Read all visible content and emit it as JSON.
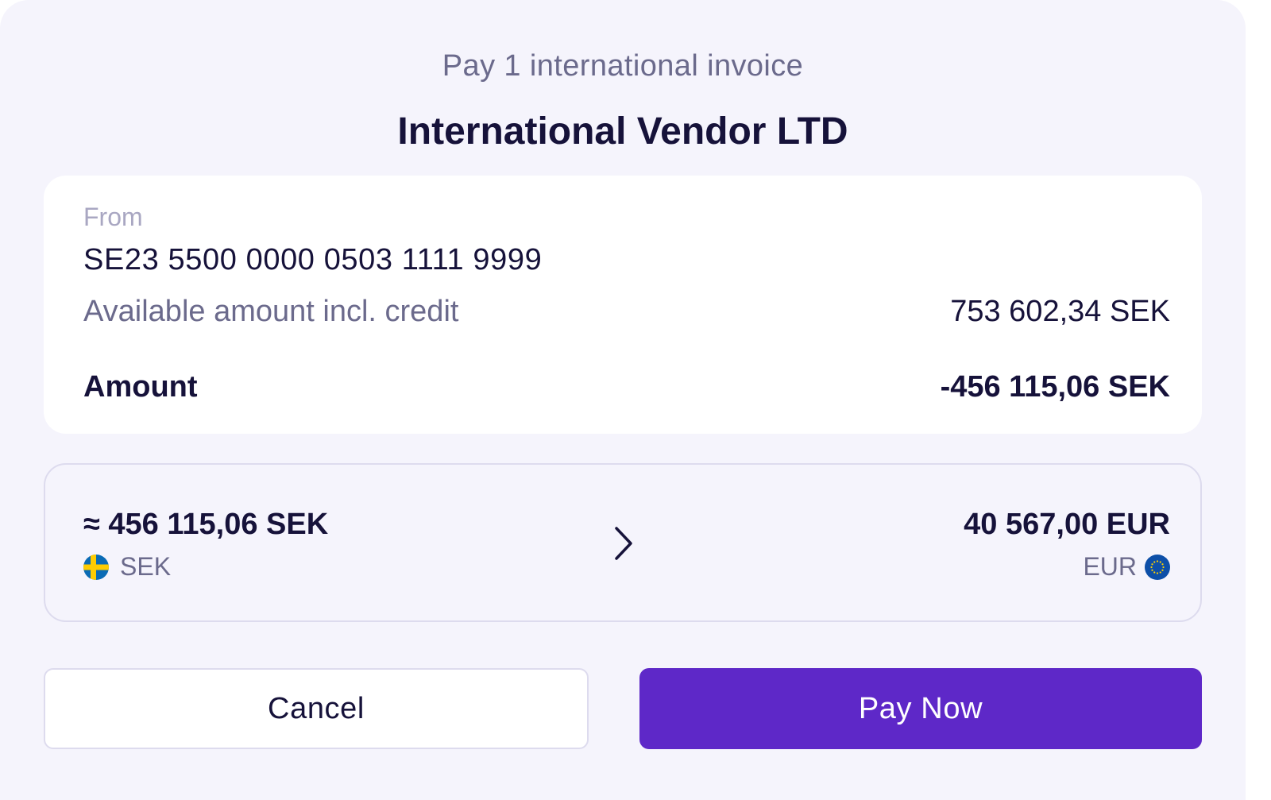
{
  "dialog": {
    "subtitle": "Pay 1 international invoice",
    "vendor_name": "International Vendor LTD"
  },
  "details": {
    "from_label": "From",
    "account_number": "SE23 5500 0000 0503 1111 9999",
    "available_label": "Available amount incl. credit",
    "available_value": "753 602,34 SEK",
    "amount_label": "Amount",
    "amount_value": "-456 115,06 SEK"
  },
  "conversion": {
    "from_amount": "≈ 456 115,06 SEK",
    "from_currency": "SEK",
    "from_flag_icon": "sweden-flag-icon",
    "to_amount": "40 567,00 EUR",
    "to_currency": "EUR",
    "to_flag_icon": "eu-flag-icon",
    "arrow_icon": "chevron-right-icon"
  },
  "actions": {
    "cancel_label": "Cancel",
    "pay_label": "Pay Now"
  },
  "colors": {
    "background": "#f5f4fc",
    "text_primary": "#16123a",
    "text_secondary": "#6b6a8c",
    "primary_button": "#5e28c8",
    "border": "#dddbee"
  }
}
